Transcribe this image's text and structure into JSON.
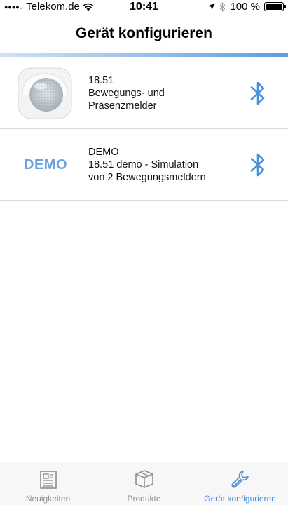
{
  "status_bar": {
    "carrier": "Telekom.de",
    "time": "10:41",
    "battery": "100 %",
    "battery_level": 1.0
  },
  "nav": {
    "title": "Gerät konfigurieren"
  },
  "devices": [
    {
      "line1": "18.51",
      "line2": "Bewegungs- und",
      "line3": "Präsenzmelder",
      "icon": "bluetooth-icon"
    },
    {
      "logo": "DEMO",
      "line1": "DEMO",
      "line2": "18.51 demo - Simulation",
      "line3": "von 2 Bewegungsmeldern",
      "icon": "bluetooth-icon"
    }
  ],
  "tabs": [
    {
      "label": "Neuigkeiten",
      "icon": "newspaper-icon",
      "active": false
    },
    {
      "label": "Produkte",
      "icon": "box-icon",
      "active": false
    },
    {
      "label": "Gerät konfigurieren",
      "icon": "wrench-icon",
      "active": true
    }
  ],
  "colors": {
    "accent": "#4a8fd8",
    "demo_logo": "#6aa3de",
    "inactive_tab": "#8e8e93"
  }
}
